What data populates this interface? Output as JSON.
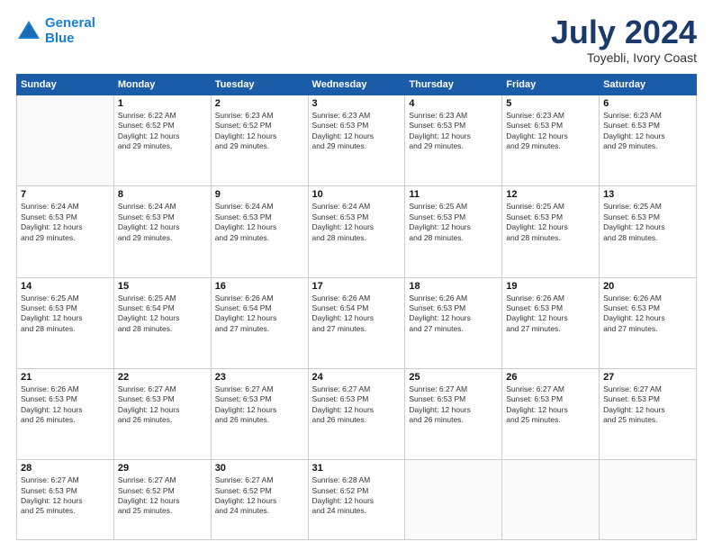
{
  "header": {
    "logo_line1": "General",
    "logo_line2": "Blue",
    "month": "July 2024",
    "location": "Toyebli, Ivory Coast"
  },
  "weekdays": [
    "Sunday",
    "Monday",
    "Tuesday",
    "Wednesday",
    "Thursday",
    "Friday",
    "Saturday"
  ],
  "weeks": [
    [
      {
        "day": "",
        "info": ""
      },
      {
        "day": "1",
        "info": "Sunrise: 6:22 AM\nSunset: 6:52 PM\nDaylight: 12 hours\nand 29 minutes."
      },
      {
        "day": "2",
        "info": "Sunrise: 6:23 AM\nSunset: 6:52 PM\nDaylight: 12 hours\nand 29 minutes."
      },
      {
        "day": "3",
        "info": "Sunrise: 6:23 AM\nSunset: 6:53 PM\nDaylight: 12 hours\nand 29 minutes."
      },
      {
        "day": "4",
        "info": "Sunrise: 6:23 AM\nSunset: 6:53 PM\nDaylight: 12 hours\nand 29 minutes."
      },
      {
        "day": "5",
        "info": "Sunrise: 6:23 AM\nSunset: 6:53 PM\nDaylight: 12 hours\nand 29 minutes."
      },
      {
        "day": "6",
        "info": "Sunrise: 6:23 AM\nSunset: 6:53 PM\nDaylight: 12 hours\nand 29 minutes."
      }
    ],
    [
      {
        "day": "7",
        "info": "Sunrise: 6:24 AM\nSunset: 6:53 PM\nDaylight: 12 hours\nand 29 minutes."
      },
      {
        "day": "8",
        "info": "Sunrise: 6:24 AM\nSunset: 6:53 PM\nDaylight: 12 hours\nand 29 minutes."
      },
      {
        "day": "9",
        "info": "Sunrise: 6:24 AM\nSunset: 6:53 PM\nDaylight: 12 hours\nand 29 minutes."
      },
      {
        "day": "10",
        "info": "Sunrise: 6:24 AM\nSunset: 6:53 PM\nDaylight: 12 hours\nand 28 minutes."
      },
      {
        "day": "11",
        "info": "Sunrise: 6:25 AM\nSunset: 6:53 PM\nDaylight: 12 hours\nand 28 minutes."
      },
      {
        "day": "12",
        "info": "Sunrise: 6:25 AM\nSunset: 6:53 PM\nDaylight: 12 hours\nand 28 minutes."
      },
      {
        "day": "13",
        "info": "Sunrise: 6:25 AM\nSunset: 6:53 PM\nDaylight: 12 hours\nand 28 minutes."
      }
    ],
    [
      {
        "day": "14",
        "info": "Sunrise: 6:25 AM\nSunset: 6:53 PM\nDaylight: 12 hours\nand 28 minutes."
      },
      {
        "day": "15",
        "info": "Sunrise: 6:25 AM\nSunset: 6:54 PM\nDaylight: 12 hours\nand 28 minutes."
      },
      {
        "day": "16",
        "info": "Sunrise: 6:26 AM\nSunset: 6:54 PM\nDaylight: 12 hours\nand 27 minutes."
      },
      {
        "day": "17",
        "info": "Sunrise: 6:26 AM\nSunset: 6:54 PM\nDaylight: 12 hours\nand 27 minutes."
      },
      {
        "day": "18",
        "info": "Sunrise: 6:26 AM\nSunset: 6:53 PM\nDaylight: 12 hours\nand 27 minutes."
      },
      {
        "day": "19",
        "info": "Sunrise: 6:26 AM\nSunset: 6:53 PM\nDaylight: 12 hours\nand 27 minutes."
      },
      {
        "day": "20",
        "info": "Sunrise: 6:26 AM\nSunset: 6:53 PM\nDaylight: 12 hours\nand 27 minutes."
      }
    ],
    [
      {
        "day": "21",
        "info": "Sunrise: 6:26 AM\nSunset: 6:53 PM\nDaylight: 12 hours\nand 26 minutes."
      },
      {
        "day": "22",
        "info": "Sunrise: 6:27 AM\nSunset: 6:53 PM\nDaylight: 12 hours\nand 26 minutes."
      },
      {
        "day": "23",
        "info": "Sunrise: 6:27 AM\nSunset: 6:53 PM\nDaylight: 12 hours\nand 26 minutes."
      },
      {
        "day": "24",
        "info": "Sunrise: 6:27 AM\nSunset: 6:53 PM\nDaylight: 12 hours\nand 26 minutes."
      },
      {
        "day": "25",
        "info": "Sunrise: 6:27 AM\nSunset: 6:53 PM\nDaylight: 12 hours\nand 26 minutes."
      },
      {
        "day": "26",
        "info": "Sunrise: 6:27 AM\nSunset: 6:53 PM\nDaylight: 12 hours\nand 25 minutes."
      },
      {
        "day": "27",
        "info": "Sunrise: 6:27 AM\nSunset: 6:53 PM\nDaylight: 12 hours\nand 25 minutes."
      }
    ],
    [
      {
        "day": "28",
        "info": "Sunrise: 6:27 AM\nSunset: 6:53 PM\nDaylight: 12 hours\nand 25 minutes."
      },
      {
        "day": "29",
        "info": "Sunrise: 6:27 AM\nSunset: 6:52 PM\nDaylight: 12 hours\nand 25 minutes."
      },
      {
        "day": "30",
        "info": "Sunrise: 6:27 AM\nSunset: 6:52 PM\nDaylight: 12 hours\nand 24 minutes."
      },
      {
        "day": "31",
        "info": "Sunrise: 6:28 AM\nSunset: 6:52 PM\nDaylight: 12 hours\nand 24 minutes."
      },
      {
        "day": "",
        "info": ""
      },
      {
        "day": "",
        "info": ""
      },
      {
        "day": "",
        "info": ""
      }
    ]
  ]
}
